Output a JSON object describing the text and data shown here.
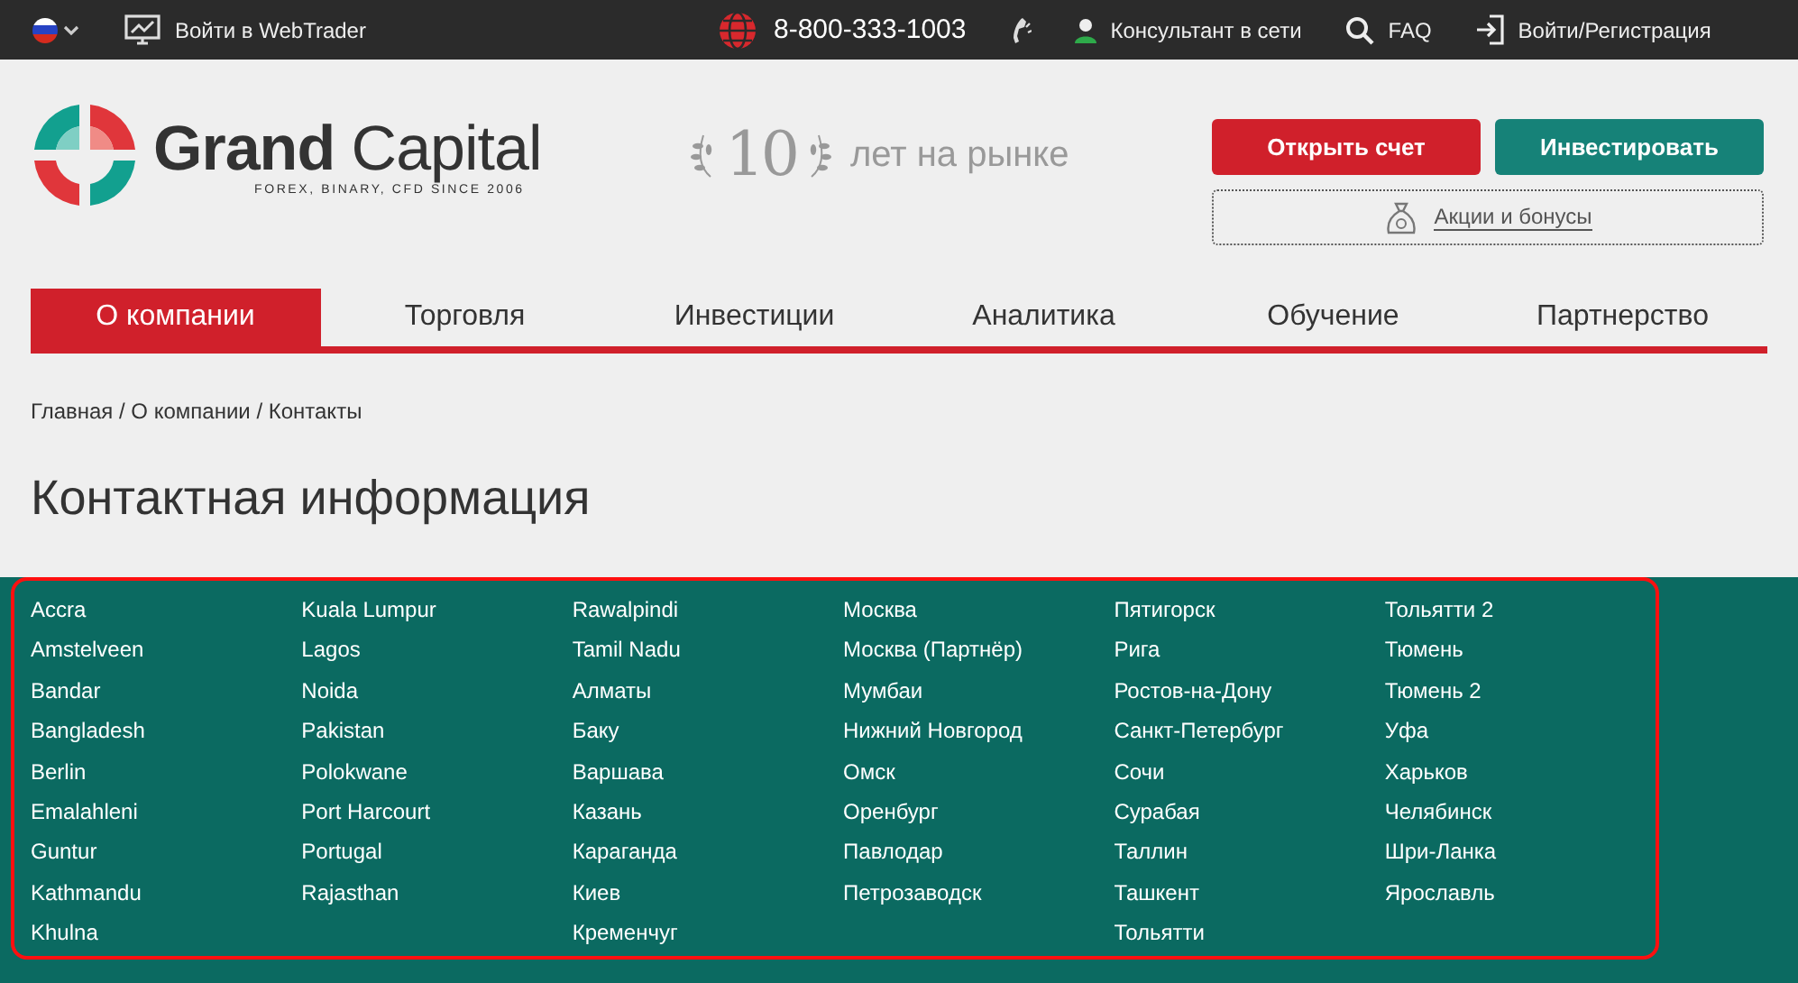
{
  "top_bar": {
    "webtrader": "Войти в WebTrader",
    "phone": "8-800-333-1003",
    "consultant": "Консультант в сети",
    "faq": "FAQ",
    "login": "Войти/Регистрация"
  },
  "logo": {
    "name_bold": "Grand",
    "name_light": "Capital",
    "tagline": "FOREX, BINARY, CFD  SINCE 2006"
  },
  "years_badge": {
    "number": "10",
    "text": "лет на рынке"
  },
  "buttons": {
    "open_account": "Открыть счет",
    "invest": "Инвестировать",
    "promo": "Акции и бонусы"
  },
  "nav": [
    {
      "label": "О компании",
      "selected": true
    },
    {
      "label": "Торговля",
      "selected": false
    },
    {
      "label": "Инвестиции",
      "selected": false
    },
    {
      "label": "Аналитика",
      "selected": false
    },
    {
      "label": "Обучение",
      "selected": false
    },
    {
      "label": "Партнерство",
      "selected": false
    }
  ],
  "breadcrumb": "Главная / О компании / Контакты",
  "title": "Контактная информация",
  "offices": [
    [
      "Accra",
      "Amstelveen",
      "Bandar",
      "Bangladesh",
      "Berlin",
      "Emalahleni",
      "Guntur",
      "Kathmandu",
      "Khulna"
    ],
    [
      "Kuala Lumpur",
      "Lagos",
      "Noida",
      "Pakistan",
      "Polokwane",
      "Port Harcourt",
      "Portugal",
      "Rajasthan"
    ],
    [
      "Rawalpindi",
      "Tamil Nadu",
      "Алматы",
      "Баку",
      "Варшава",
      "Казань",
      "Караганда",
      "Киев",
      "Кременчуг"
    ],
    [
      "Москва",
      "Москва (Партнёр)",
      "Мумбаи",
      "Нижний Новгород",
      "Омск",
      "Оренбург",
      "Павлодар",
      "Петрозаводск"
    ],
    [
      "Пятигорск",
      "Рига",
      "Ростов-на-Дону",
      "Санкт-Петербург",
      "Сочи",
      "Сурабая",
      "Таллин",
      "Ташкент",
      "Тольятти"
    ],
    [
      "Тольятти 2",
      "Тюмень",
      "Тюмень 2",
      "Уфа",
      "Харьков",
      "Челябинск",
      "Шри-Ланка",
      "Ярославль"
    ]
  ]
}
